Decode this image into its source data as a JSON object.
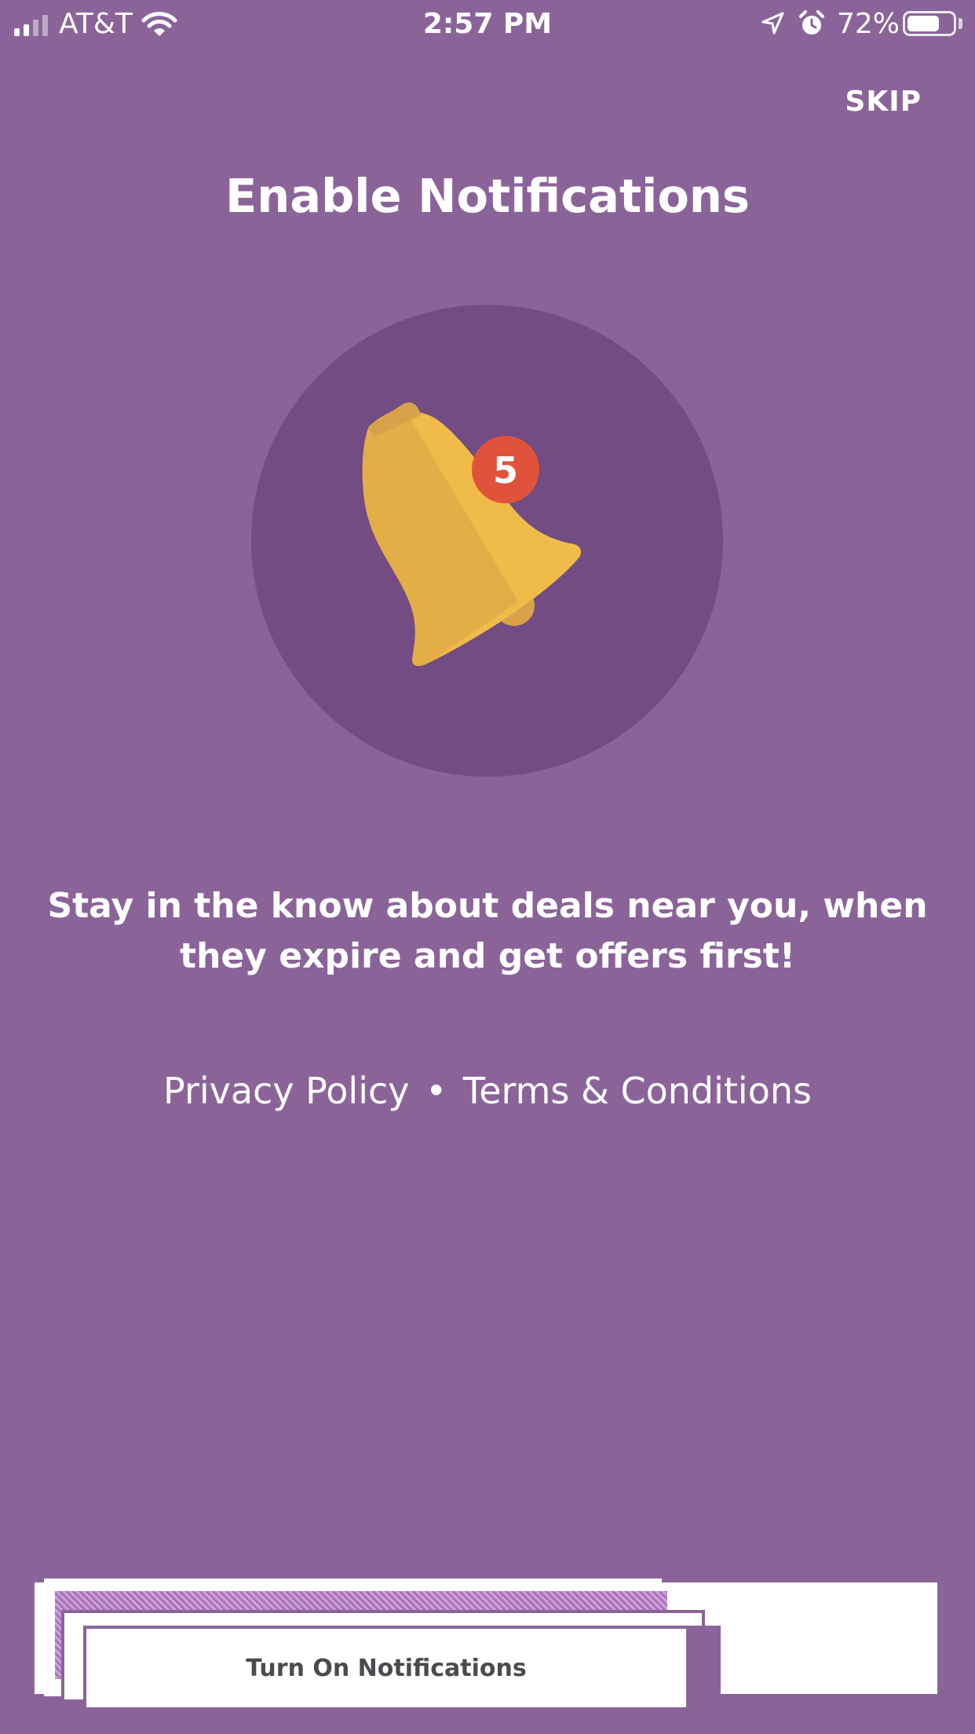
{
  "status_bar": {
    "carrier": "AT&T",
    "time": "2:57 PM",
    "battery_percent": "72%",
    "battery_level": 0.72,
    "icons": [
      "signal-icon",
      "wifi-icon",
      "location-icon",
      "alarm-icon",
      "battery-icon"
    ]
  },
  "header": {
    "skip_label": "SKIP",
    "title": "Enable Notifications"
  },
  "hero": {
    "icon": "bell-icon",
    "badge_count": "5",
    "colors": {
      "circle": "#724c82",
      "bell": "#f0bb49",
      "bell_shade": "#e3ab45",
      "badge": "#e0533a"
    }
  },
  "body": {
    "line1": "Stay in the know about deals near you, when",
    "line2": "they expire and get offers first!"
  },
  "links": {
    "privacy": "Privacy Policy",
    "separator": "•",
    "terms": "Terms & Conditions"
  },
  "cta": {
    "label": "Turn On Notifications"
  },
  "theme": {
    "background": "#8a6498",
    "text": "#ffffff"
  }
}
